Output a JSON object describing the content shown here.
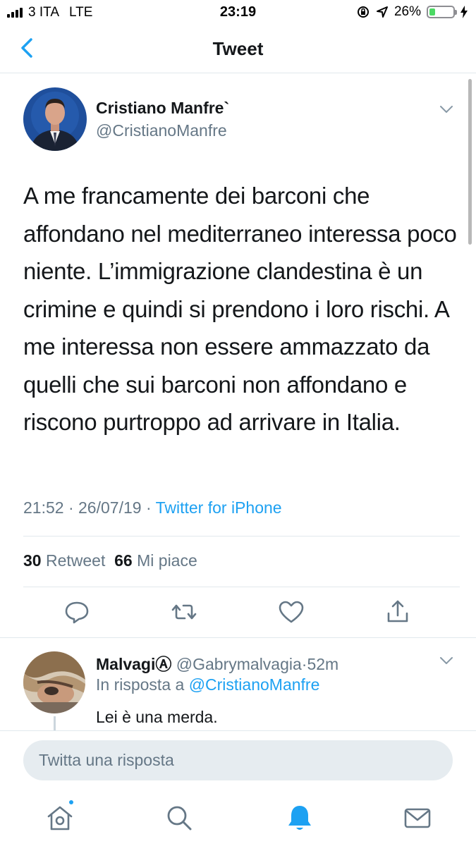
{
  "status_bar": {
    "carrier": "3 ITA",
    "network": "LTE",
    "time": "23:19",
    "battery": "26%",
    "battery_level": 0.26,
    "battery_color": "#4cd964",
    "icons": [
      "signal-icon",
      "screen-lock-icon",
      "location-icon",
      "battery-icon",
      "charging-icon"
    ]
  },
  "nav": {
    "back_icon": "chevron-left-icon",
    "title": "Tweet"
  },
  "tweet": {
    "author_name": "Cristiano Manfre`",
    "author_handle": "@CristianoManfre",
    "text": "A me francamente dei barconi che affondano nel mediterraneo interessa poco niente. L’immigrazione clandestina è un crimine e quindi si prendono i loro rischi. A me interessa non essere ammazzato da quelli che sui barconi non affondano e riscono purtroppo ad arrivare in Italia.",
    "time": "21:52",
    "date": "26/07/19",
    "separator": "·",
    "source": "Twitter for iPhone",
    "retweet_count": "30",
    "retweet_label": "Retweet",
    "like_count": "66",
    "like_label": "Mi piace",
    "action_icons": [
      "reply-icon",
      "retweet-icon",
      "like-icon",
      "share-icon"
    ]
  },
  "reply": {
    "name": "MalvagiⒶ",
    "handle": "@Gabrymalvagia",
    "separator": "·",
    "age": "52m",
    "in_reply_prefix": "In risposta a",
    "in_reply_mention": "@CristianoManfre",
    "text": "Lei è una merda."
  },
  "compose": {
    "placeholder": "Twitta una risposta"
  },
  "tab_bar": {
    "tabs": [
      "home-icon",
      "search-icon",
      "notifications-icon",
      "messages-icon"
    ],
    "active": "notifications-icon"
  },
  "colors": {
    "accent": "#1da1f2",
    "secondary_text": "#657786",
    "primary_text": "#14171a",
    "divider": "#e1e8ed",
    "input_bg": "#e6ecf0"
  }
}
